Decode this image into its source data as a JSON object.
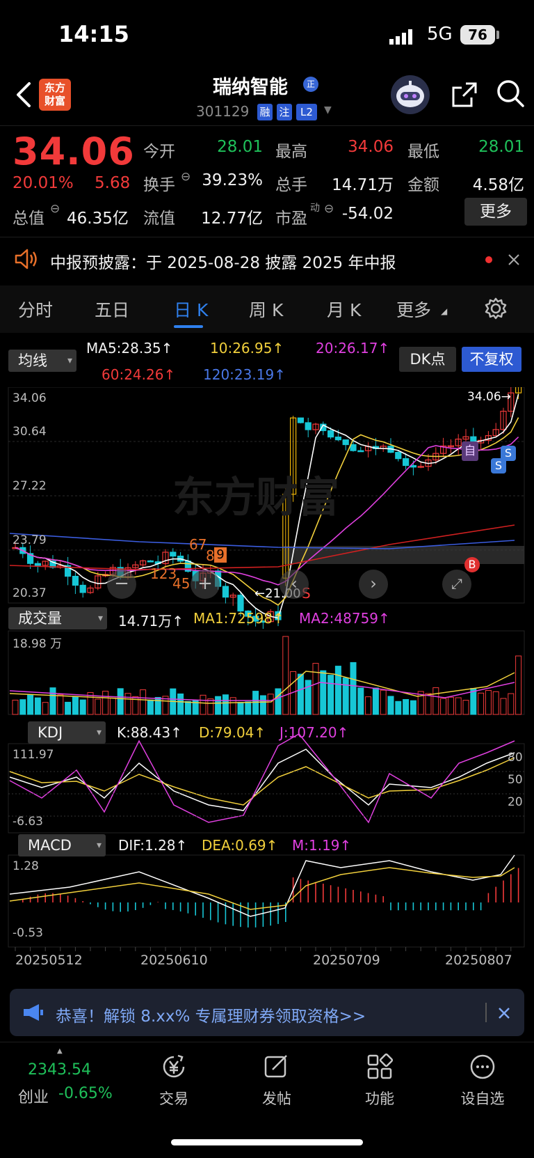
{
  "status_bar": {
    "time": "14:15",
    "network": "5G",
    "battery": "76"
  },
  "header": {
    "logo_line1": "东方",
    "logo_line2": "财富",
    "stock_name": "瑞纳智能",
    "flag": "正",
    "stock_code": "301129",
    "tags": [
      "融",
      "注",
      "L2"
    ]
  },
  "quote": {
    "price": "34.06",
    "change_pct": "20.01%",
    "change_val": "5.68",
    "open_label": "今开",
    "open": "28.01",
    "high_label": "最高",
    "high": "34.06",
    "low_label": "最低",
    "low": "28.01",
    "turnover_label": "换手",
    "turnover": "39.23%",
    "volume_label": "总手",
    "volume": "14.71万",
    "amount_label": "金额",
    "amount": "4.58亿",
    "mktcap_label": "总值",
    "mktcap": "46.35亿",
    "float_label": "流值",
    "float_cap": "12.77亿",
    "pe_label": "市盈",
    "pe_sup": "动",
    "pe": "-54.02",
    "more_label": "更多"
  },
  "notice": {
    "text": "中报预披露：于 2025-08-28 披露 2025 年中报"
  },
  "tabs": [
    "分时",
    "五日",
    "日 K",
    "周 K",
    "月 K",
    "更多"
  ],
  "active_tab": "日 K",
  "ma_bar": {
    "selector": "均线",
    "ma5": "MA5:28.35↑",
    "ma10": "10:26.95↑",
    "ma20": "20:26.17↑",
    "ma60": "60:24.26↑",
    "ma120": "120:23.19↑",
    "dk_label": "DK点",
    "adjust_label": "不复权"
  },
  "kline": {
    "y_labels": [
      "34.06",
      "30.64",
      "27.22",
      "23.79",
      "20.37"
    ],
    "last_label": "34.06→",
    "low_label": "←21.00",
    "watermark": "东方财富",
    "markers": [
      "123",
      "45",
      "67",
      "8",
      "9"
    ],
    "signal_s": "S",
    "signal_b": "B",
    "signal_zi": "自"
  },
  "volume_panel": {
    "selector": "成交量",
    "value": "14.71万↑",
    "ma1": "MA1:72598↑",
    "ma2": "MA2:48759↑",
    "max_label": "18.98 万"
  },
  "kdj_panel": {
    "selector": "KDJ",
    "k": "K:88.43↑",
    "d": "D:79.04↑",
    "j": "J:107.20↑",
    "top": "111.97",
    "bottom": "-6.63",
    "l80": "80",
    "l50": "50",
    "l20": "20"
  },
  "macd_panel": {
    "selector": "MACD",
    "dif": "DIF:1.28↑",
    "dea": "DEA:0.69↑",
    "m": "M:1.19↑",
    "top": "1.28",
    "bottom": "-0.53"
  },
  "dates": [
    "20250512",
    "20250610",
    "20250709",
    "20250807"
  ],
  "promo": {
    "text": "恭喜！解锁 8.xx% 专属理财券领取资格>>"
  },
  "bottom_bar": {
    "index_value": "2343.54",
    "index_name": "创业",
    "index_change": "-0.65%",
    "items": [
      "交易",
      "发帖",
      "功能",
      "设自选"
    ]
  },
  "colors": {
    "up": "#f23a3a",
    "down": "#17c7d6",
    "ma5": "#ffffff",
    "ma10": "#f2d03c",
    "ma20": "#e040e0",
    "ma60": "#d02020",
    "ma120": "#3b5de0",
    "accent": "#2f80ed"
  }
}
